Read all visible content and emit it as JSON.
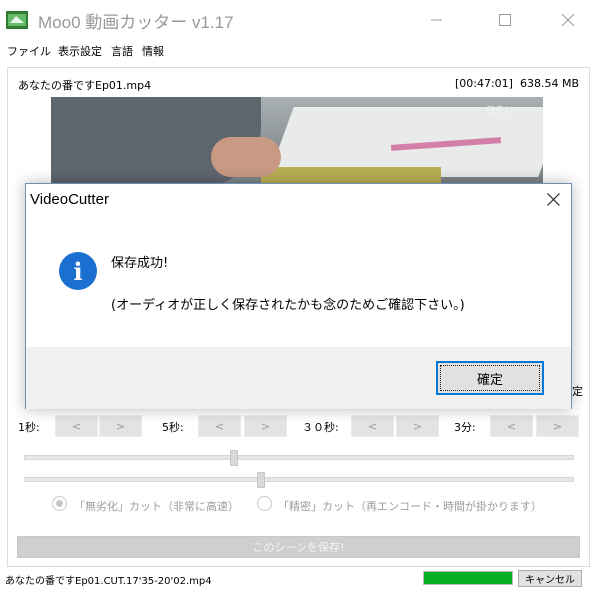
{
  "window": {
    "title": "Moo0 動画カッター v1.17"
  },
  "menu": [
    "ファイル",
    "表示設定",
    "言語",
    "情報"
  ],
  "video": {
    "file_name": "あなたの番ですEp01.mp4",
    "duration": "[00:47:01]",
    "size": "638.54 MB",
    "watermark": "日テレ"
  },
  "partial_right_char": "定",
  "navigation": [
    {
      "label": "1秒:",
      "back": "<",
      "forward": ">"
    },
    {
      "label": "5秒:",
      "back": "<",
      "forward": ">"
    },
    {
      "label": "３０秒:",
      "back": "<",
      "forward": ">"
    },
    {
      "label": "3分:",
      "back": "<",
      "forward": ">"
    }
  ],
  "sliders": [
    {
      "value_fraction": 0.38
    },
    {
      "value_fraction": 0.43
    }
  ],
  "cut_mode": {
    "options": [
      {
        "label": "「無劣化」カット（非常に高速）",
        "checked": true
      },
      {
        "label": "「精密」カット（再エンコード・時間が掛かります）",
        "checked": false
      }
    ]
  },
  "save_scene_label": "このシーンを保存!",
  "status": {
    "output_file": "あなたの番ですEp01.CUT.17'35-20'02.mp4",
    "progress_fraction": 1.0,
    "cancel_label": "キャンセル"
  },
  "dialog": {
    "title": "VideoCutter",
    "icon": "info-icon",
    "message_line1": "保存成功!",
    "message_line2": "(オーディオが正しく保存されたかも念のためご確認下さい。)",
    "ok_label": "確定"
  },
  "colors": {
    "progress": "#06b025",
    "info_icon": "#1a6fd1",
    "focus_border": "#0078d7"
  }
}
